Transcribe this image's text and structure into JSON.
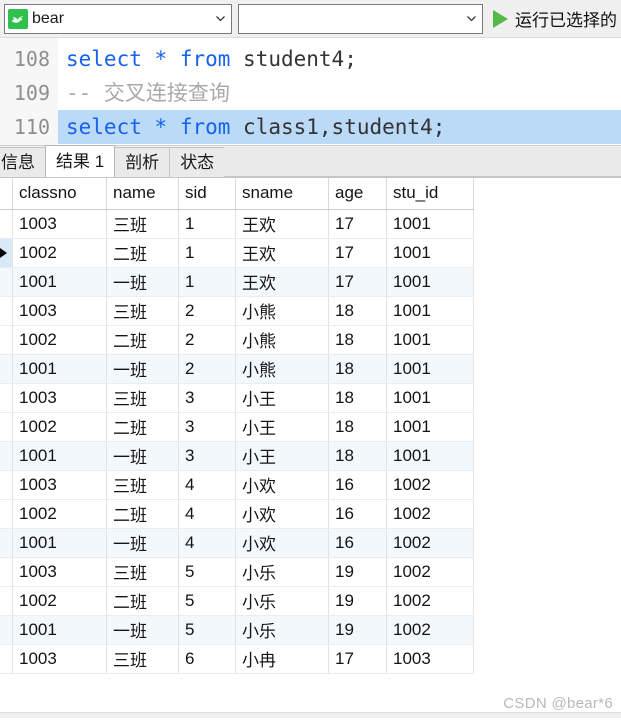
{
  "toolbar": {
    "db_icon": "database-dolphin-icon",
    "connection_value": "bear",
    "connection_placeholder": "",
    "schema_value": "",
    "schema_placeholder": "",
    "dropdown_icon": "chevron-down-icon",
    "run_icon": "play-triangle-icon",
    "run_label": "运行已选择的"
  },
  "editor": {
    "lines": [
      {
        "number": "108",
        "selected": false,
        "tokens": [
          {
            "text": "select",
            "type": "kw"
          },
          {
            "text": " ",
            "type": "id"
          },
          {
            "text": "*",
            "type": "op"
          },
          {
            "text": " ",
            "type": "id"
          },
          {
            "text": "from",
            "type": "kw"
          },
          {
            "text": " student4;",
            "type": "id"
          }
        ]
      },
      {
        "number": "109",
        "selected": false,
        "tokens": [
          {
            "text": "-- 交叉连接查询",
            "type": "comment"
          }
        ]
      },
      {
        "number": "110",
        "selected": true,
        "tokens": [
          {
            "text": "select",
            "type": "kw"
          },
          {
            "text": " ",
            "type": "id"
          },
          {
            "text": "*",
            "type": "op"
          },
          {
            "text": " ",
            "type": "id"
          },
          {
            "text": "from",
            "type": "kw"
          },
          {
            "text": " class1,student4;",
            "type": "id"
          }
        ]
      }
    ]
  },
  "tabs": [
    {
      "label": "信息",
      "active": false
    },
    {
      "label": "结果 1",
      "active": true
    },
    {
      "label": "剖析",
      "active": false
    },
    {
      "label": "状态",
      "active": false
    }
  ],
  "result_grid": {
    "columns": [
      "classno",
      "name",
      "sid",
      "sname",
      "age",
      "stu_id"
    ],
    "selected_column": "classno",
    "current_row_index": 1,
    "rows": [
      [
        "1003",
        "三班",
        "1",
        "王欢",
        "17",
        "1001"
      ],
      [
        "1002",
        "二班",
        "1",
        "王欢",
        "17",
        "1001"
      ],
      [
        "1001",
        "一班",
        "1",
        "王欢",
        "17",
        "1001"
      ],
      [
        "1003",
        "三班",
        "2",
        "小熊",
        "18",
        "1001"
      ],
      [
        "1002",
        "二班",
        "2",
        "小熊",
        "18",
        "1001"
      ],
      [
        "1001",
        "一班",
        "2",
        "小熊",
        "18",
        "1001"
      ],
      [
        "1003",
        "三班",
        "3",
        "小王",
        "18",
        "1001"
      ],
      [
        "1002",
        "二班",
        "3",
        "小王",
        "18",
        "1001"
      ],
      [
        "1001",
        "一班",
        "3",
        "小王",
        "18",
        "1001"
      ],
      [
        "1003",
        "三班",
        "4",
        "小欢",
        "16",
        "1002"
      ],
      [
        "1002",
        "二班",
        "4",
        "小欢",
        "16",
        "1002"
      ],
      [
        "1001",
        "一班",
        "4",
        "小欢",
        "16",
        "1002"
      ],
      [
        "1003",
        "三班",
        "5",
        "小乐",
        "19",
        "1002"
      ],
      [
        "1002",
        "二班",
        "5",
        "小乐",
        "19",
        "1002"
      ],
      [
        "1001",
        "一班",
        "5",
        "小乐",
        "19",
        "1002"
      ],
      [
        "1003",
        "三班",
        "6",
        "小冉",
        "17",
        "1003"
      ]
    ]
  },
  "watermark": {
    "text": "CSDN @bear*6"
  },
  "colors": {
    "accent_green": "#2ec14e",
    "run_green": "#54b948",
    "keyword_blue": "#1662f0",
    "selection_blue": "#badaf7",
    "header_highlight": "#d8e9f7",
    "alt_row": "#f3f8fc"
  }
}
